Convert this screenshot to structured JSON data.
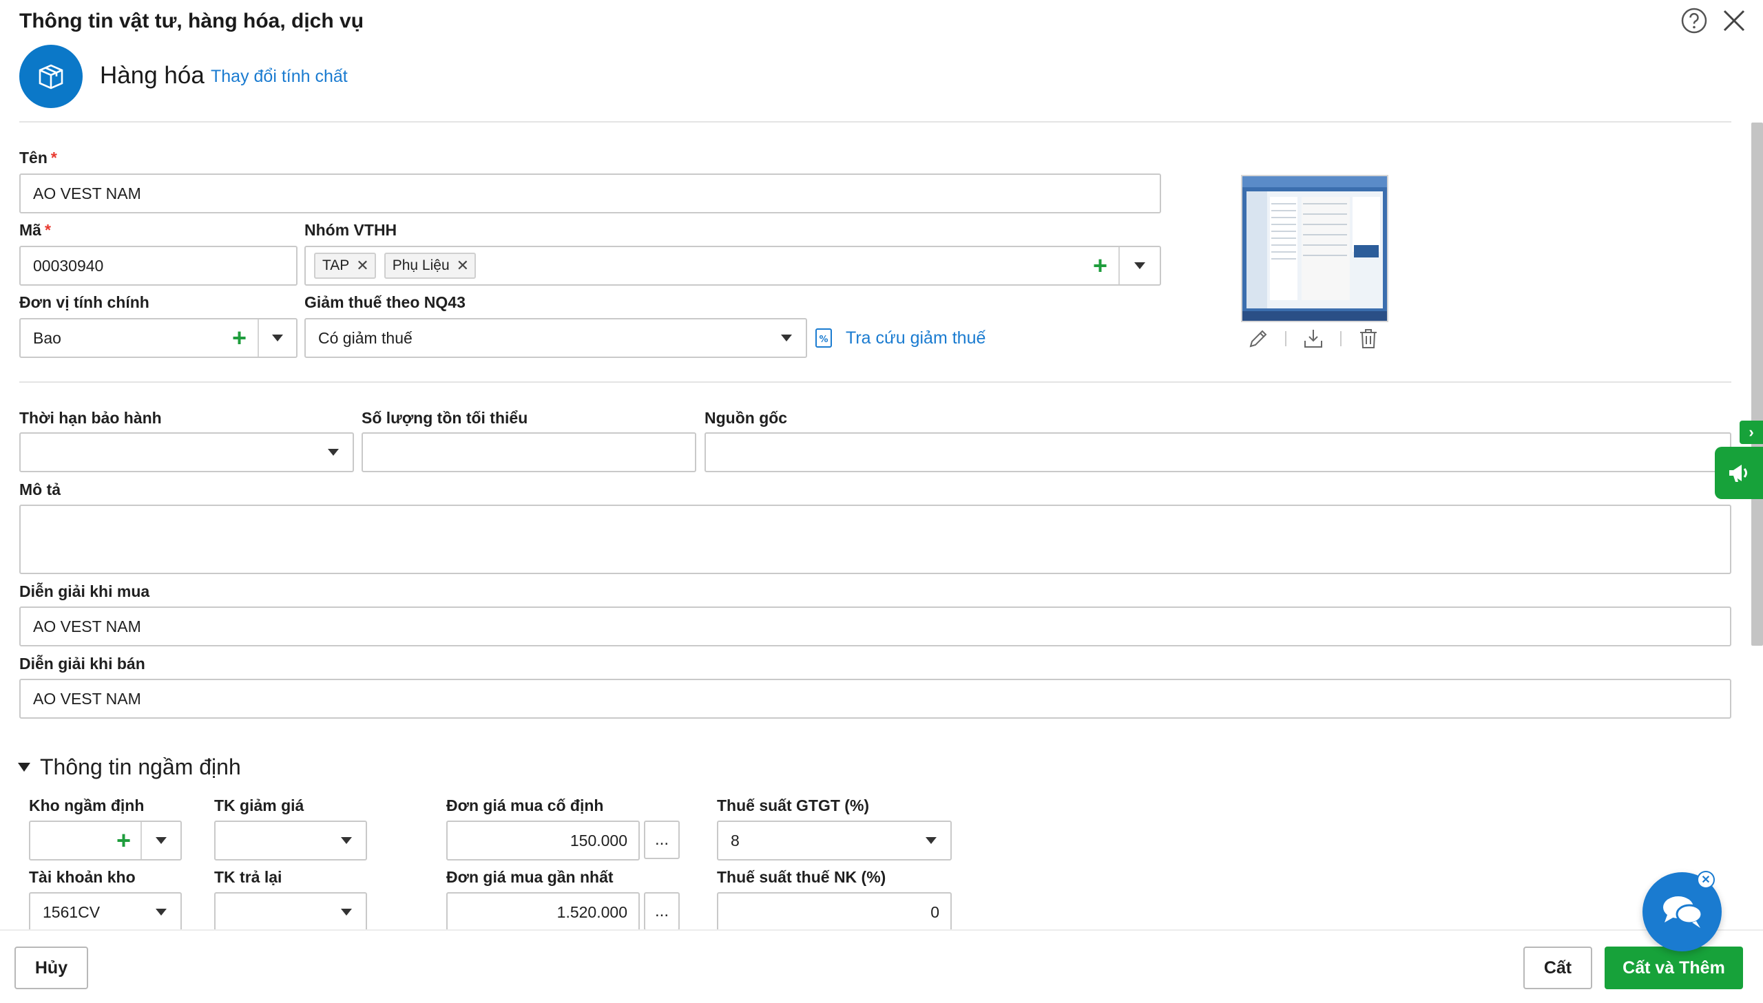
{
  "dialog": {
    "title": "Thông tin vật tư, hàng hóa, dịch vụ"
  },
  "type": {
    "icon": "box-icon",
    "label": "Hàng hóa",
    "change_link": "Thay đổi tính chất"
  },
  "fields": {
    "ten": {
      "label": "Tên",
      "value": "AO VEST NAM"
    },
    "ma": {
      "label": "Mã",
      "value": "00030940"
    },
    "nhom": {
      "label": "Nhóm VTHH",
      "tags": [
        "TAP",
        "Phụ Liệu"
      ]
    },
    "don_vi": {
      "label": "Đơn vị tính chính",
      "value": "Bao"
    },
    "giam_thue": {
      "label": "Giảm thuế theo NQ43",
      "value": "Có giảm thuế",
      "lookup_link": "Tra cứu giảm thuế"
    },
    "bao_hanh": {
      "label": "Thời hạn bảo hành",
      "value": ""
    },
    "ton_toi_thieu": {
      "label": "Số lượng tồn tối thiểu",
      "value": ""
    },
    "nguon_goc": {
      "label": "Nguồn gốc",
      "value": ""
    },
    "mo_ta": {
      "label": "Mô tả",
      "value": ""
    },
    "dien_giai_mua": {
      "label": "Diễn giải khi mua",
      "value": "AO VEST NAM"
    },
    "dien_giai_ban": {
      "label": "Diễn giải khi bán",
      "value": "AO VEST NAM"
    }
  },
  "defaults": {
    "section_title": "Thông tin ngầm định",
    "kho": {
      "label": "Kho ngầm định",
      "value": ""
    },
    "tk_giam_gia": {
      "label": "TK giảm giá",
      "value": ""
    },
    "don_gia_co_dinh": {
      "label": "Đơn giá mua cố định",
      "value": "150.000"
    },
    "thue_gtgt": {
      "label": "Thuế suất GTGT (%)",
      "value": "8"
    },
    "tai_khoan_kho": {
      "label": "Tài khoản kho",
      "value": "1561CV"
    },
    "tk_tra_lai": {
      "label": "TK trả lại",
      "value": ""
    },
    "don_gia_gan_nhat": {
      "label": "Đơn giá mua gần nhất",
      "value": "1.520.000"
    },
    "thue_nk": {
      "label": "Thuế suất thuế NK (%)",
      "value": "0"
    },
    "ellipsis": "..."
  },
  "footer": {
    "cancel": "Hủy",
    "save": "Cất",
    "save_add": "Cất và Thêm"
  },
  "colors": {
    "accent_blue": "#1a7bd0",
    "brand_green": "#17a23a",
    "required_red": "#e8392f"
  }
}
